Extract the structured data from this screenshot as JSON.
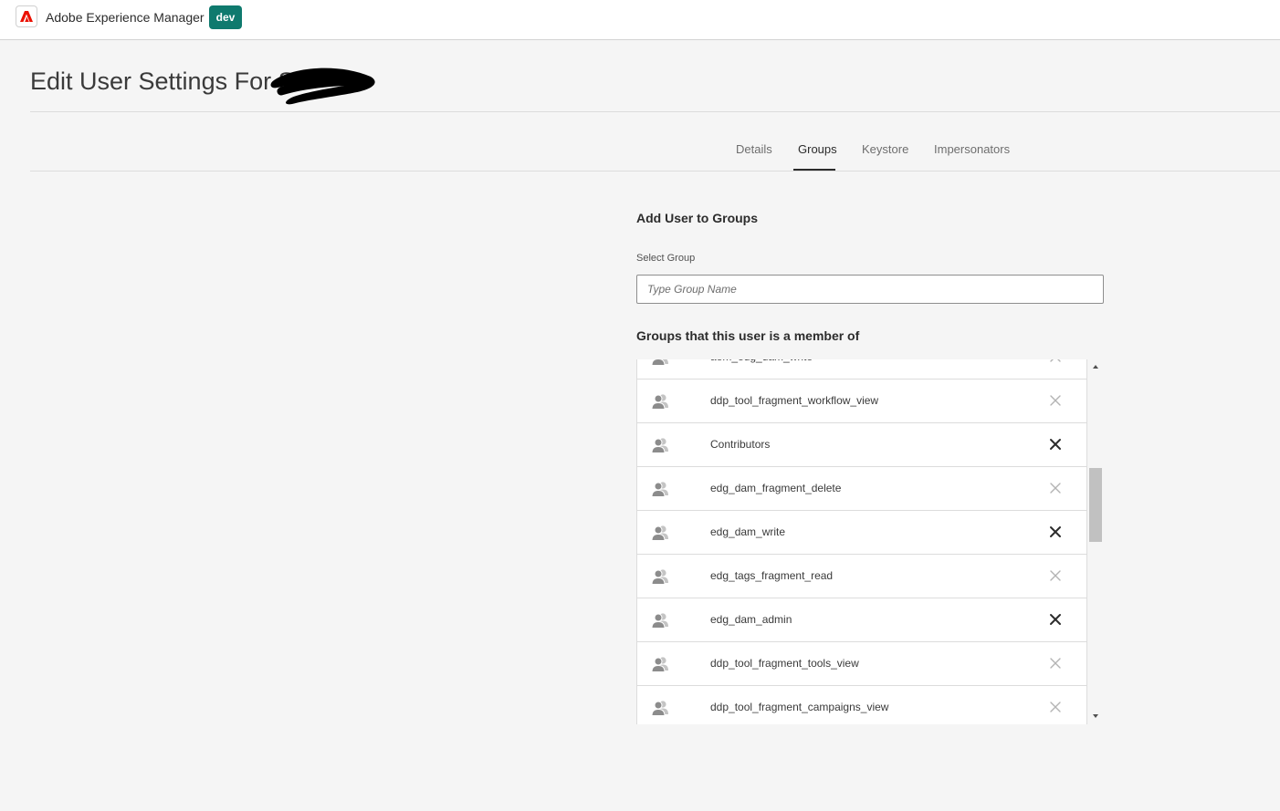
{
  "header": {
    "app_name": "Adobe Experience Manager",
    "environment_badge": "dev",
    "brand_color": "#eb1000",
    "badge_color": "#0f7a6e"
  },
  "page": {
    "title": "Edit User Settings For Sa"
  },
  "tabs": [
    {
      "label": "Details",
      "active": false
    },
    {
      "label": "Groups",
      "active": true
    },
    {
      "label": "Keystore",
      "active": false
    },
    {
      "label": "Impersonators",
      "active": false
    }
  ],
  "add_section": {
    "heading": "Add User to Groups",
    "field_label": "Select Group",
    "placeholder": "Type Group Name",
    "value": ""
  },
  "membership": {
    "heading": "Groups that this user is a member of",
    "groups": [
      {
        "name": "aem_edg_dam_write",
        "remove_emphasized": false
      },
      {
        "name": "ddp_tool_fragment_workflow_view",
        "remove_emphasized": false
      },
      {
        "name": "Contributors",
        "remove_emphasized": true
      },
      {
        "name": "edg_dam_fragment_delete",
        "remove_emphasized": false
      },
      {
        "name": "edg_dam_write",
        "remove_emphasized": true
      },
      {
        "name": "edg_tags_fragment_read",
        "remove_emphasized": false
      },
      {
        "name": "edg_dam_admin",
        "remove_emphasized": true
      },
      {
        "name": "ddp_tool_fragment_tools_view",
        "remove_emphasized": false
      },
      {
        "name": "ddp_tool_fragment_campaigns_view",
        "remove_emphasized": false
      }
    ],
    "icons": {
      "row_icon": "user-group-icon",
      "remove_icon": "close-icon"
    }
  }
}
